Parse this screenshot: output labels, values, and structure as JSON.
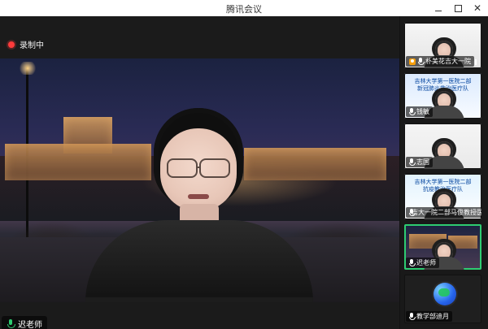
{
  "app": {
    "title": "腾讯会议"
  },
  "window_controls": {
    "minimize": "—",
    "maximize": "□",
    "close": "✕"
  },
  "main": {
    "recording_text": "录制中",
    "speaker_name": "迟老师"
  },
  "sidebar": {
    "participants": [
      {
        "name": "朴美花吉大一院",
        "type": "video",
        "host": true
      },
      {
        "name": "钱敏",
        "type": "video",
        "banner": "吉林大学第一医院二部\n新冠肺炎救治医疗队"
      },
      {
        "name": "志国",
        "type": "video"
      },
      {
        "name": "吉大一院二部马俊教授医",
        "type": "video",
        "banner": "吉林大学第一医院二部\n抗疫教治医疗队"
      },
      {
        "name": "迟老师",
        "type": "video",
        "highlight": true
      },
      {
        "name": "教学部迪月",
        "type": "avatar"
      }
    ]
  },
  "colors": {
    "title_bg": "#ffffff",
    "app_bg": "#1e1e1e",
    "record_red": "#ff3b3b",
    "mic_green": "#2ecc71"
  },
  "icons": {
    "record": "record-dot-icon",
    "mic": "microphone-icon",
    "signal": "signal-bars-icon",
    "host": "host-badge-icon",
    "earth": "earth-avatar-icon"
  }
}
